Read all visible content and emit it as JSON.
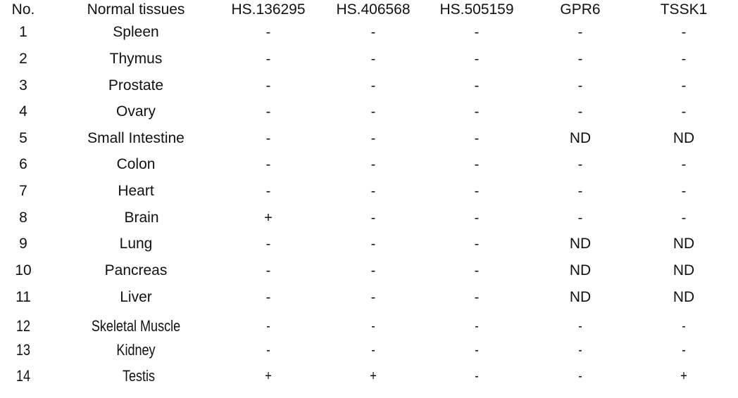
{
  "table": {
    "headers": [
      "No.",
      "Normal tissues",
      "HS.136295",
      "HS.406568",
      "HS.505159",
      "GPR6",
      "TSSK1"
    ],
    "rows": [
      {
        "no": "1",
        "tissue": "Spleen",
        "values": [
          "-",
          "-",
          "-",
          "-",
          "-"
        ]
      },
      {
        "no": "2",
        "tissue": "Thymus",
        "values": [
          "-",
          "-",
          "-",
          "-",
          "-"
        ]
      },
      {
        "no": "3",
        "tissue": "Prostate",
        "values": [
          "-",
          "-",
          "-",
          "-",
          "-"
        ]
      },
      {
        "no": "4",
        "tissue": "Ovary",
        "values": [
          "-",
          "-",
          "-",
          "-",
          "-"
        ]
      },
      {
        "no": "5",
        "tissue": "Small  Intestine",
        "values": [
          "-",
          "-",
          "-",
          "ND",
          "ND"
        ]
      },
      {
        "no": "6",
        "tissue": "Colon",
        "values": [
          "-",
          "-",
          "-",
          "-",
          "-"
        ]
      },
      {
        "no": "7",
        "tissue": "Heart",
        "values": [
          "-",
          "-",
          "-",
          "-",
          "-"
        ]
      },
      {
        "no": "8",
        "tissue": "Brain",
        "values": [
          "+",
          "-",
          "-",
          "-",
          "-"
        ]
      },
      {
        "no": "9",
        "tissue": "Lung",
        "values": [
          "-",
          "-",
          "-",
          "ND",
          "ND"
        ]
      },
      {
        "no": "10",
        "tissue": "Pancreas",
        "values": [
          "-",
          "-",
          "-",
          "ND",
          "ND"
        ]
      },
      {
        "no": "11",
        "tissue": "Liver",
        "values": [
          "-",
          "-",
          "-",
          "ND",
          "ND"
        ]
      },
      {
        "no": "12",
        "tissue": "Skeletal  Muscle",
        "values": [
          "-",
          "-",
          "-",
          "-",
          "-"
        ]
      },
      {
        "no": "13",
        "tissue": "Kidney",
        "values": [
          "-",
          "-",
          "-",
          "-",
          "-"
        ]
      },
      {
        "no": "14",
        "tissue": "Testis",
        "values": [
          "+",
          "+",
          "-",
          "-",
          "+"
        ]
      }
    ]
  }
}
